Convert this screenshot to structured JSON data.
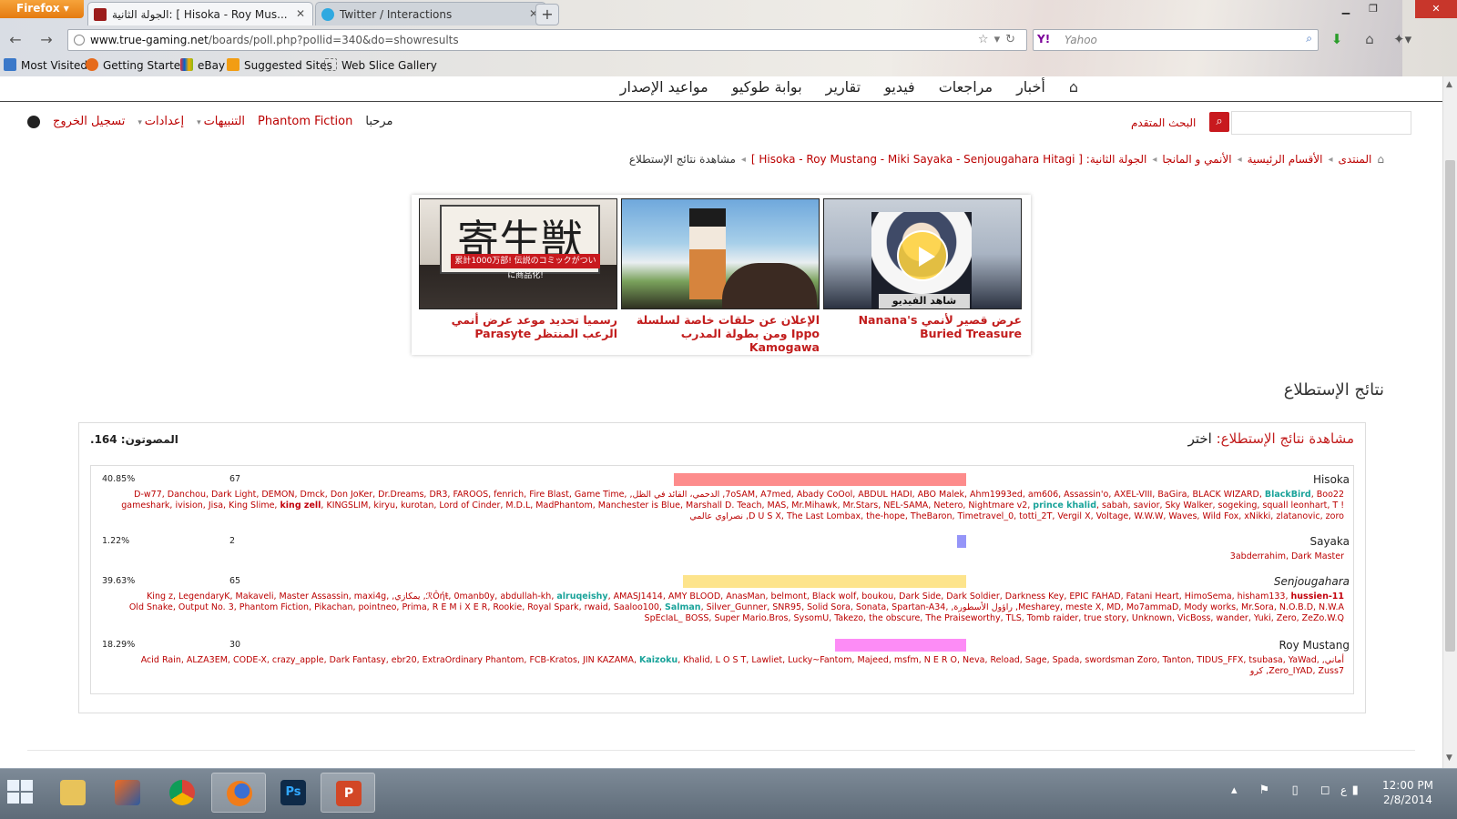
{
  "browser": {
    "menu_label": "Firefox",
    "tabs": [
      {
        "title": "الجولة الثانية: [ Hisoka - Roy Mus..."
      },
      {
        "title": "Twitter / Interactions"
      }
    ],
    "url_domain": "www.true-gaming.net",
    "url_path": "/boards/poll.php?pollid=340&do=showresults",
    "search_placeholder": "Yahoo",
    "search_engine": "Y!",
    "bookmarks": [
      "Most Visited",
      "Getting Started",
      "eBay",
      "Suggested Sites",
      "Web Slice Gallery"
    ]
  },
  "topnav": {
    "items": [
      "أخبار",
      "مراجعات",
      "فيديو",
      "تقارير",
      "بوابة طوكيو",
      "مواعيد الإصدار"
    ]
  },
  "userbar": {
    "welcome": "مرحبا",
    "username": "Phantom Fiction",
    "notifications": "التنبيهات",
    "settings": "إعدادات",
    "logout": "تسجيل الخروج",
    "advanced_search": "البحث المتقدم"
  },
  "breadcrumbs": {
    "items": [
      "المنتدى",
      "الأقسام الرئيسية",
      "الأنمي و المانجا",
      "الجولة الثانية: [ Hisoka - Roy Mustang - Miki Sayaka - Senjougahara Hitagi ]"
    ],
    "current": "مشاهدة نتائج الإستطلاع"
  },
  "promos": [
    {
      "title": "رسميا تحديد موعد عرض أنمي الرعب المنتظر Parasyte",
      "image_text": "寄生獣",
      "banner_text": "累計1000万部! 伝説のコミックがついに商品化!"
    },
    {
      "title": "الإعلان عن حلقات خاصة لسلسلة Ippo ومن بطولة المدرب Kamogawa"
    },
    {
      "title": "عرض قصير لأنمي Nanana's Buried Treasure",
      "image_label": "شاهد الفيديو"
    }
  ],
  "poll": {
    "section_title": "نتائج الإستطلاع",
    "heading_prefix": "مشاهدة نتائج الإستطلاع:",
    "heading_question": "اختر",
    "voters_total": "المصوتون: 164.",
    "options": [
      {
        "name": "Hisoka",
        "percent": "40.85%",
        "count": "67",
        "share": 40.85,
        "color": "#fd8c8c",
        "voters_before": "7oSAM, A7med, Abady CoOol, ABDUL HADI, ABO Malek, Ahm1993ed, am606, Assassin'o, AXEL-VIII, BaGira, BLACK WIZARD,",
        "highlight1": "BlackBird",
        "voters_mid": ", Boo22, الدحمي، القائد في الظل, D-w77, Danchou, Dark Light, DEMON, Dmck, Don JoKer, Dr.Dreams, DR3, FAROOS, fenrich, Fire Blast, Game Time, gameshark, ivision, Jisa, King Slime,",
        "bold1": "king zell",
        "voters_mid2": ", KINGSLIM, kiryu, kurotan, Lord of Cinder, M.D.L, MadPhantom, Manchester is Blue, Marshall D. Teach, MAS, Mr.Mihawk, Mr.Stars, NEL-SAMA, Netero, Nightmare v2,",
        "highlight2": "prince khalid",
        "voters_after": ", sabah, savior, Sky Walker, sogeking, squall leonhart, T ! D U S X, The Last Lombax, the-hope, TheBaron, Timetravel_0, totti_2T, Vergil X, Voltage, W.W.W, Waves, Wild Fox, xNikki, zlatanovic, zoro, نصراوي عالمي"
      },
      {
        "name": "Sayaka",
        "percent": "1.22%",
        "count": "2",
        "share": 1.22,
        "color": "#9595f8",
        "voters_before": "3abderrahim, Dark Master"
      },
      {
        "name": "Senjougahara",
        "percent": "39.63%",
        "count": "65",
        "share": 39.63,
        "color": "#fde48c",
        "voters_before": "ℛÔήŧ, 0manb0y, abdullah-kh,",
        "highlight1": "alruqeishy",
        "voters_mid": ", AMASJ1414, AMY BLOOD, AnasMan, belmont, Black wolf, boukou, Dark Side, Dark Soldier, Darkness Key, EPIC FAHAD, Fatani Heart, HimoSema, hisham133,",
        "bold1": "hussien-11",
        "voters_mid2": ", يمكازي, King z, LegendaryK, Makaveli, Master Assassin, maxi4g, Mesharey, meste X, MD, Mo7ammaD, Mody works, Mr.Sora, N.O.B.D, N.W.A, راؤول الأسطورة, Old Snake, Output No. 3, Phantom Fiction, Pikachan, pointneo, Prima, R E M i X E R, Rookie, Royal Spark, rwaid, Saaloo100,",
        "highlight2": "Salman",
        "voters_after": ", Silver_Gunner, SNR95, Solid Sora, Sonata, Spartan-A34, SpEcIaL_ BOSS, Super Mario.Bros, SysomU, Takezo, the obscure, The Praiseworthy, TLS, Tomb raider, true story, Unknown, VicBoss, wander, Yuki, Zero, ZeZo.W.Q"
      },
      {
        "name": "Roy Mustang",
        "percent": "18.29%",
        "count": "30",
        "share": 18.29,
        "color": "#fd8cf6",
        "voters_before": "أماني, Acid Rain, ALZA3EM, CODE-X, crazy_apple, Dark Fantasy, ebr20, ExtraOrdinary Phantom, FCB-Kratos, JIN KAZAMA,",
        "highlight1": "Kaizoku",
        "voters_after": ", Khalid, L O S T, Lawliet, Lucky~Fantom, Majeed, msfm, N E R O, Neva, Reload, Sage, Spada, swordsman Zoro, Tanton, TIDUS_FFX, tsubasa, YaWad, Zero_IYAD, Zuss7, كرو"
      }
    ]
  },
  "taskbar": {
    "time": "12:00 PM",
    "date": "2/8/2014",
    "lang": "ع"
  }
}
